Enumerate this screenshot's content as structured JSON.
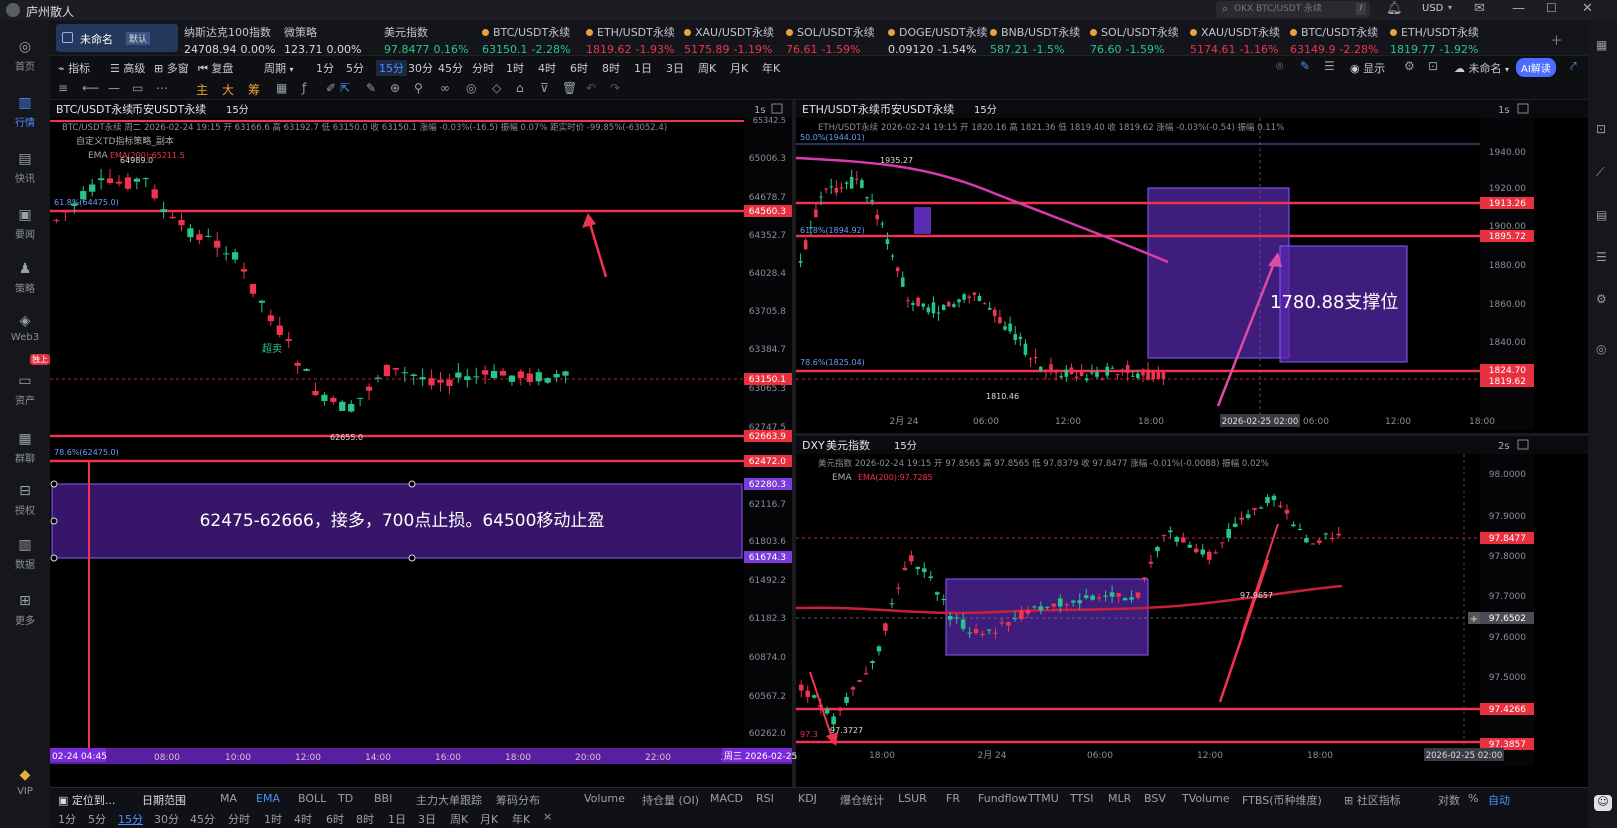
{
  "window": {
    "title": "庐州散人"
  },
  "search": {
    "placeholder": "OKX BTC/USDT 永续"
  },
  "top_right": {
    "currency": "USD"
  },
  "left_nav": [
    {
      "label": "首页",
      "icon": "home-icon"
    },
    {
      "label": "行情",
      "icon": "chart-icon"
    },
    {
      "label": "快讯",
      "icon": "news-icon"
    },
    {
      "label": "要闻",
      "icon": "headline-icon"
    },
    {
      "label": "策略",
      "icon": "strategy-icon"
    },
    {
      "label": "Web3",
      "icon": "web3-icon"
    },
    {
      "label": "资产",
      "icon": "asset-icon"
    },
    {
      "label": "群聊",
      "icon": "chat-icon"
    },
    {
      "label": "授权",
      "icon": "auth-icon"
    },
    {
      "label": "数据",
      "icon": "data-icon"
    },
    {
      "label": "更多",
      "icon": "more-icon"
    },
    {
      "label": "VIP",
      "icon": "vip-icon"
    }
  ],
  "left_nav_badge": "独上",
  "workspace": {
    "name": "未命名",
    "tag": "默认"
  },
  "tickers": [
    {
      "name": "纳斯达克100指数",
      "price": "24708.94",
      "change": "0.00%",
      "dir": "wht"
    },
    {
      "name": "微策略",
      "price": "123.71",
      "change": "0.00%",
      "dir": "wht"
    },
    {
      "name": "美元指数",
      "price": "97.8477",
      "change": "0.16%",
      "dir": "grn"
    },
    {
      "name": "BTC/USDT永续",
      "price": "63150.1",
      "change": "-2.28%",
      "dir": "grn"
    },
    {
      "name": "ETH/USDT永续",
      "price": "1819.62",
      "change": "-1.93%",
      "dir": "red"
    },
    {
      "name": "XAU/USDT永续",
      "price": "5175.89",
      "change": "-1.19%",
      "dir": "red"
    },
    {
      "name": "SOL/USDT永续",
      "price": "76.61",
      "change": "-1.59%",
      "dir": "red"
    },
    {
      "name": "DOGE/USDT永续",
      "price": "0.09120",
      "change": "-1.54%",
      "dir": "wht"
    },
    {
      "name": "BNB/USDT永续",
      "price": "587.21",
      "change": "-1.5%",
      "dir": "grn"
    },
    {
      "name": "SOL/USDT永续",
      "price": "76.60",
      "change": "-1.59%",
      "dir": "grn"
    },
    {
      "name": "XAU/USDT永续",
      "price": "5174.61",
      "change": "-1.16%",
      "dir": "red"
    },
    {
      "name": "BTC/USDT永续",
      "price": "63149.9",
      "change": "-2.28%",
      "dir": "red"
    },
    {
      "name": "ETH/USDT永续",
      "price": "1819.77",
      "change": "-1.92%",
      "dir": "grn"
    }
  ],
  "toolbar": {
    "indicator": "指标",
    "advanced": "高级",
    "multi": "多窗",
    "replay": "复盘",
    "period": "周期",
    "periods": [
      "1分",
      "5分",
      "15分",
      "30分",
      "45分",
      "分时",
      "1时",
      "4时",
      "6时",
      "8时",
      "1日",
      "3日",
      "周K",
      "月K",
      "年K"
    ],
    "selected_period": "15分",
    "display": "显示",
    "unnamed": "未命名",
    "ai": "AI解读"
  },
  "draw_chars": [
    "主",
    "大",
    "筹"
  ],
  "btc": {
    "title": "BTC/USDT永续",
    "exchange": "币安USDT永续",
    "interval": "15分",
    "refresh": "1s",
    "info": "BTC/USDT永续 周二 2026-02-24 19:15 开 63166.6 高 63192.7 低 63150.0 收 63150.1 涨幅 -0.03%(-16.5) 振幅 0.07% 距实时价 -99.85%(-63052.4)",
    "strategy": "自定义TD指标策略_副本",
    "ema": "EMA",
    "ema_value": "EMA(200):65211.5",
    "high_label": "64989.0",
    "low_label": "62655.0",
    "oversold": "超卖",
    "fib61": "61.8%(64475.0)",
    "fib78": "78.6%(62475.0)",
    "axis": [
      "65006.3",
      "64678.7",
      "64352.7",
      "64028.4",
      "63705.8",
      "63384.7",
      "63065.3",
      "62747.5",
      "62116.7",
      "61803.6",
      "61492.2",
      "61182.3",
      "60874.0",
      "60567.2",
      "60262.0"
    ],
    "top_axis": "65342.5",
    "lines": [
      "64560.3",
      "62663.9",
      "62472.0",
      "62280.3",
      "61674.3"
    ],
    "last_price": "63150.1",
    "note": "62475-62666，接多，700点止损。64500移动止盈",
    "xlabels": [
      "08:00",
      "10:00",
      "12:00",
      "14:00",
      "16:00",
      "18:00",
      "20:00",
      "22:00",
      "2/"
    ],
    "cursor_date": "02-24 04:45",
    "right_date": "周三 2026-02-25"
  },
  "eth": {
    "title": "ETH/USDT永续",
    "exchange": "币安USDT永续",
    "interval": "15分",
    "refresh": "1s",
    "info": "ETH/USDT永续 2026-02-24 19:15 开 1820.16 高 1821.36 低 1819.40 收 1819.62 涨幅 -0.03%(-0.54) 振幅 0.11%",
    "fib50": "50.0%(1944.01)",
    "fib61": "61.8%(1894.92)",
    "fib78": "78.6%(1825.04)",
    "high_label": "1935.27",
    "low_label": "1810.46",
    "axis": [
      "1940.00",
      "1920.00",
      "1900.00",
      "1880.00",
      "1860.00",
      "1840.00"
    ],
    "lines": [
      "1913.26",
      "1895.72",
      "1824.70"
    ],
    "last_price": "1819.62",
    "note": "1780.88支撑位",
    "xlabels": [
      "2月 24",
      "06:00",
      "12:00",
      "18:00",
      "06:00",
      "12:00",
      "18:00"
    ],
    "cursor_date": "2026-02-25 02:00"
  },
  "dxy": {
    "title": "DXY",
    "exchange": "美元指数",
    "interval": "15分",
    "refresh": "2s",
    "info": "美元指数 2026-02-24 19:15 开 97.8565 高 97.8565 低 97.8379 收 97.8477 涨幅 -0.01%(-0.0088) 振幅 0.02%",
    "ema": "EMA",
    "ema_value": "EMA(200):97.7285",
    "high_label": "97.9657",
    "low_label": "97.3727",
    "low_red": "97.3",
    "axis": [
      "98.0000",
      "97.9000",
      "97.8000",
      "97.7000",
      "97.6000",
      "97.5000"
    ],
    "lines": [
      "97.4266",
      "97.3857"
    ],
    "last_price": "97.8477",
    "cross_price": "97.6502",
    "xlabels": [
      "18:00",
      "2月 24",
      "06:00",
      "12:00",
      "18:00"
    ],
    "cursor_date": "2026-02-25 02:00"
  },
  "bottom": {
    "locate": "定位到...",
    "range": "日期范围",
    "indicators": [
      "MA",
      "EMA",
      "BOLL",
      "TD",
      "BBI",
      "主力大单跟踪",
      "筹码分布",
      "Volume",
      "持仓量 (OI)",
      "MACD",
      "RSI",
      "KDJ",
      "爆仓统计",
      "LSUR",
      "FR",
      "Fundflow",
      "TTMU",
      "TTSI",
      "MLR",
      "BSV",
      "TVolume",
      "FTBS(币种维度)"
    ],
    "active_indicator": "EMA",
    "community": "社区指标",
    "log": "对数",
    "pct": "%",
    "auto": "自动",
    "periods": [
      "1分",
      "5分",
      "15分",
      "30分",
      "45分",
      "分时",
      "1时",
      "4时",
      "6时",
      "8时",
      "1日",
      "3日",
      "周K",
      "月K",
      "年K"
    ],
    "selected_period": "15分"
  }
}
